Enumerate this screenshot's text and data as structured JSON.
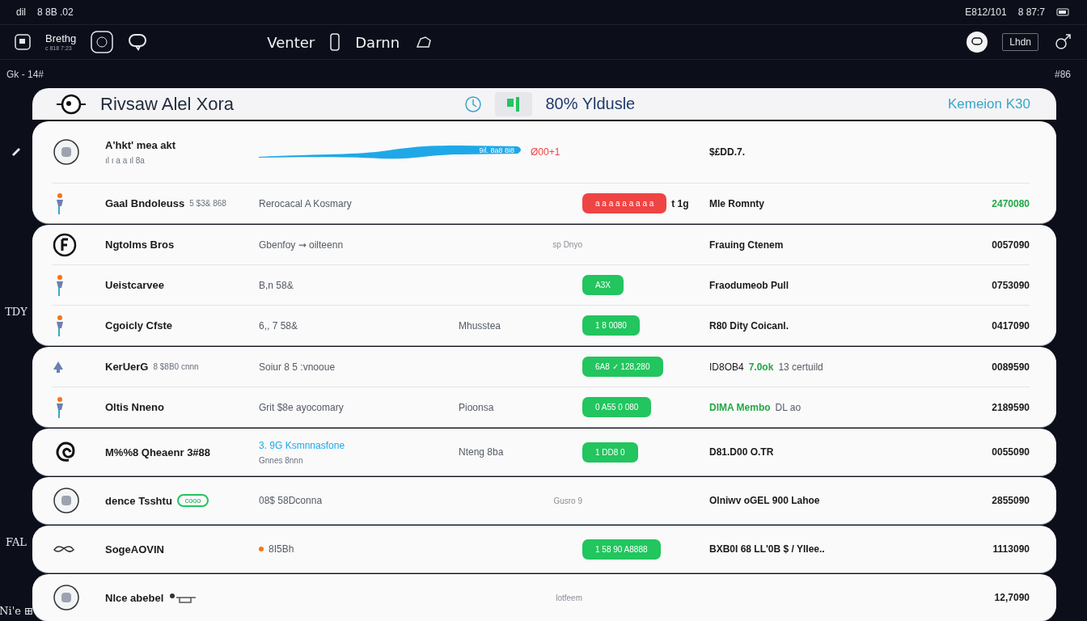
{
  "status_bar": {
    "left": [
      "dil",
      "8 8B .02"
    ],
    "right": [
      "E812/101",
      "8 87:7"
    ]
  },
  "nav": {
    "brand": "Brethg",
    "brand_sub": "c 818 7:23",
    "center": [
      "Venter",
      "Darnn"
    ],
    "right_button": "Lhdn"
  },
  "subbar": {
    "left": "Gk - 14#",
    "right": "#86"
  },
  "sidebar_labels": [
    "TDY",
    "FAL",
    "Ni'e ⊞"
  ],
  "header": {
    "title": "Rivsaw Alel Xora",
    "stat": "80% Yldusle",
    "link": "Kemeion K30"
  },
  "groups": [
    {
      "rows": [
        {
          "kind": "wave",
          "name": "A'hkt' mea akt",
          "sub": "ıl ı a a ıl 8a",
          "wave_label": "9il. 8a8 8i8",
          "reading": "Ø00+1",
          "col4": "$£DD.7."
        },
        {
          "kind": "plain",
          "name": "Gaal Bndoleuss",
          "name_note": "5 $3& 868",
          "col2": "Rerocacal A Kosmary",
          "pill": {
            "text": "a a a a a a a a a",
            "color": "#ef4444"
          },
          "pill_note": "t 1g",
          "col4": "Mle Romnty",
          "value": "2470080",
          "value_highlight": true
        }
      ]
    },
    {
      "rows": [
        {
          "kind": "plain",
          "name": "Ngtolms Bros",
          "col2": "Gbenfoy ⇝ oilteenn",
          "muted": "sp Dnyo",
          "col4": "Frauing Ctenem",
          "value": "0057090",
          "value_highlight": false
        },
        {
          "kind": "plain",
          "name": "Ueistcarvee",
          "col2": "B,n 58&",
          "pill": {
            "text": "A3X",
            "color": "#22c55e"
          },
          "col4": "Fraodumeob Pull",
          "value": "0753090",
          "value_highlight": false
        },
        {
          "kind": "plain",
          "name": "Cgoicly Cfste",
          "col2": "6,, 7 58&",
          "note": "Mhusstea",
          "pill": {
            "text": "1 8 0080",
            "color": "#22c55e"
          },
          "col4": "R80 Dity Coicanl.",
          "value": "0417090",
          "value_highlight": false
        }
      ]
    },
    {
      "rows": [
        {
          "kind": "plain",
          "name": "KerUerG",
          "name_note": "8 $8B0 cnnn",
          "col2": "Soiur 8 5 :vnooue",
          "pill": {
            "text": "6A8 ✓ 128,280",
            "color": "#22c55e"
          },
          "col4": "ID8OB4",
          "col4_accent": "7.0ok",
          "col4_tail": "13 certuild",
          "value": "0089590",
          "value_highlight": false
        },
        {
          "kind": "plain",
          "name": "Oltis Nneno",
          "col2": "Grit $8e ayocomary",
          "note": "Pioonsa",
          "pill": {
            "text": "0 A55 0 080",
            "color": "#22c55e"
          },
          "col4_accent": "DIMA Membo",
          "col4_tail": "DL ao",
          "value": "2189590",
          "value_highlight": false
        }
      ]
    },
    {
      "rows": [
        {
          "kind": "plain",
          "name": "M%%8 Qheaenr 3#88",
          "col2_accent": "3. 9G Ksmnnasfone",
          "col2_sub": "Gnnes 8nnn",
          "note": "Nteng 8ba",
          "pill": {
            "text": "1 DD8 0",
            "color": "#22c55e"
          },
          "col4": "D81.D00 O.TR",
          "value": "0055090",
          "value_highlight": false
        }
      ]
    },
    {
      "rows": [
        {
          "kind": "plain",
          "name": "dence Tsshtu",
          "name_tag": "cooo",
          "col2": "08$ 58Dconna",
          "muted": "Gusro 9",
          "col4": "Olniwv oGEL 900 Lahoe",
          "value": "2855090",
          "value_highlight": false
        }
      ]
    },
    {
      "rows": [
        {
          "kind": "plain",
          "name": "SogeAOVIN",
          "dot": {
            "color": "#f97316"
          },
          "col2": "8I5Bh",
          "pill": {
            "text": "1 58 90 A8888",
            "color": "#22c55e"
          },
          "col4": "BXB0I 68 LL'0B $ / YIIee..",
          "value": "1113090",
          "value_highlight": false
        }
      ]
    },
    {
      "rows": [
        {
          "kind": "plain",
          "name": "Nlce abebel",
          "name_tool": true,
          "muted": "lotfeem",
          "value": "12,7090",
          "value_highlight": false
        }
      ]
    }
  ]
}
